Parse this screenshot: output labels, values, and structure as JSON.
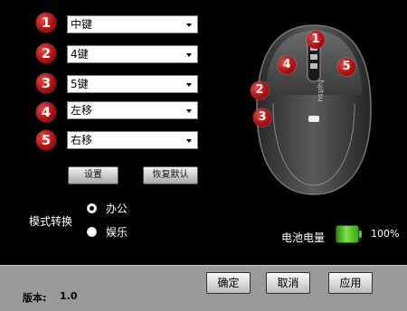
{
  "rows": [
    {
      "num": "1",
      "value": "中键"
    },
    {
      "num": "2",
      "value": "4键"
    },
    {
      "num": "3",
      "value": "5键"
    },
    {
      "num": "4",
      "value": "左移"
    },
    {
      "num": "5",
      "value": "右移"
    }
  ],
  "buttons": {
    "settings": "设置",
    "restore_default": "恢复默认"
  },
  "mode": {
    "label": "模式转换",
    "options": [
      {
        "label": "办公",
        "selected": true
      },
      {
        "label": "娱乐",
        "selected": false
      }
    ]
  },
  "mouse": {
    "badges": [
      "1",
      "2",
      "3",
      "4",
      "5"
    ],
    "brand": "fujitsu"
  },
  "battery": {
    "label": "电池电量",
    "percent_text": "100%",
    "level": 1.0,
    "color": "#5cbf2e"
  },
  "footer": {
    "version_label": "版本:",
    "version_value": "1.0",
    "ok": "确定",
    "cancel": "取消",
    "apply": "应用"
  },
  "colors": {
    "badge": "#c41a1a",
    "background": "#000000",
    "footer": "#9a9a9a"
  }
}
